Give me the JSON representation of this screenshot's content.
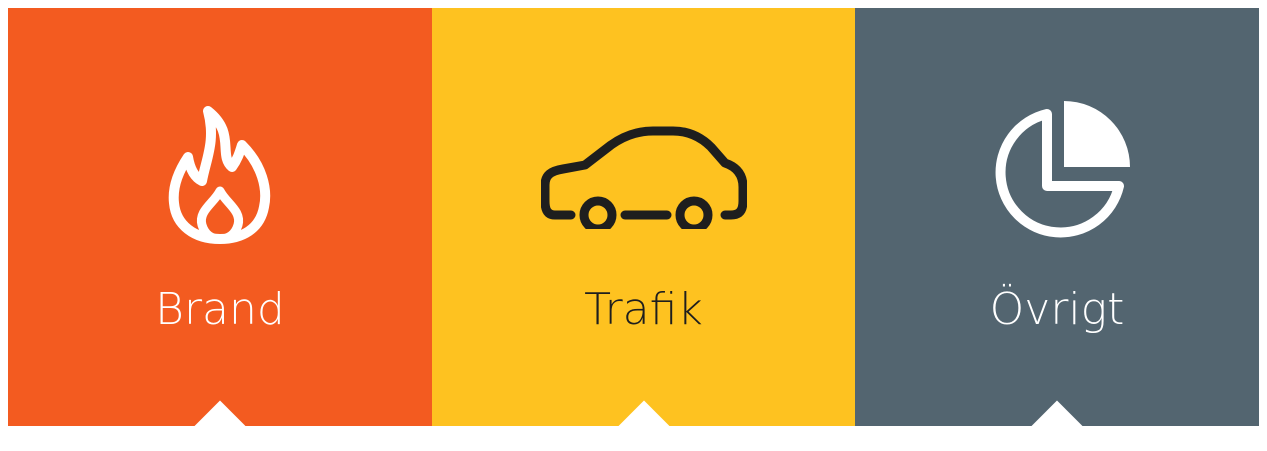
{
  "tiles": [
    {
      "label": "Brand",
      "icon": "fire-icon",
      "background": "#F35B20",
      "foreground": "#FFFFFF"
    },
    {
      "label": "Trafik",
      "icon": "car-icon",
      "background": "#FEC220",
      "foreground": "#1E1E1E"
    },
    {
      "label": "Övrigt",
      "icon": "pie-chart-icon",
      "background": "#536570",
      "foreground": "#FFFFFF"
    }
  ]
}
